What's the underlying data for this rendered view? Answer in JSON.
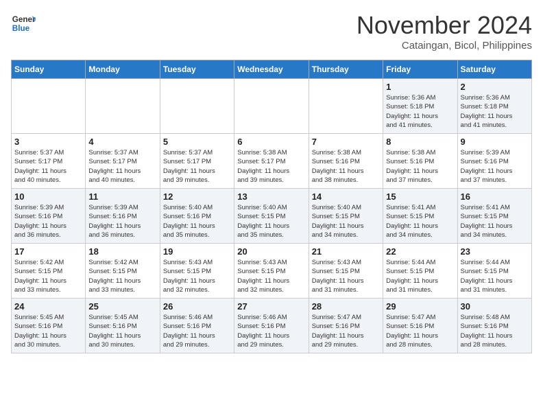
{
  "header": {
    "logo_line1": "General",
    "logo_line2": "Blue",
    "month": "November 2024",
    "location": "Cataingan, Bicol, Philippines"
  },
  "weekdays": [
    "Sunday",
    "Monday",
    "Tuesday",
    "Wednesday",
    "Thursday",
    "Friday",
    "Saturday"
  ],
  "weeks": [
    [
      {
        "day": "",
        "info": ""
      },
      {
        "day": "",
        "info": ""
      },
      {
        "day": "",
        "info": ""
      },
      {
        "day": "",
        "info": ""
      },
      {
        "day": "",
        "info": ""
      },
      {
        "day": "1",
        "info": "Sunrise: 5:36 AM\nSunset: 5:18 PM\nDaylight: 11 hours\nand 41 minutes."
      },
      {
        "day": "2",
        "info": "Sunrise: 5:36 AM\nSunset: 5:18 PM\nDaylight: 11 hours\nand 41 minutes."
      }
    ],
    [
      {
        "day": "3",
        "info": "Sunrise: 5:37 AM\nSunset: 5:17 PM\nDaylight: 11 hours\nand 40 minutes."
      },
      {
        "day": "4",
        "info": "Sunrise: 5:37 AM\nSunset: 5:17 PM\nDaylight: 11 hours\nand 40 minutes."
      },
      {
        "day": "5",
        "info": "Sunrise: 5:37 AM\nSunset: 5:17 PM\nDaylight: 11 hours\nand 39 minutes."
      },
      {
        "day": "6",
        "info": "Sunrise: 5:38 AM\nSunset: 5:17 PM\nDaylight: 11 hours\nand 39 minutes."
      },
      {
        "day": "7",
        "info": "Sunrise: 5:38 AM\nSunset: 5:16 PM\nDaylight: 11 hours\nand 38 minutes."
      },
      {
        "day": "8",
        "info": "Sunrise: 5:38 AM\nSunset: 5:16 PM\nDaylight: 11 hours\nand 37 minutes."
      },
      {
        "day": "9",
        "info": "Sunrise: 5:39 AM\nSunset: 5:16 PM\nDaylight: 11 hours\nand 37 minutes."
      }
    ],
    [
      {
        "day": "10",
        "info": "Sunrise: 5:39 AM\nSunset: 5:16 PM\nDaylight: 11 hours\nand 36 minutes."
      },
      {
        "day": "11",
        "info": "Sunrise: 5:39 AM\nSunset: 5:16 PM\nDaylight: 11 hours\nand 36 minutes."
      },
      {
        "day": "12",
        "info": "Sunrise: 5:40 AM\nSunset: 5:16 PM\nDaylight: 11 hours\nand 35 minutes."
      },
      {
        "day": "13",
        "info": "Sunrise: 5:40 AM\nSunset: 5:15 PM\nDaylight: 11 hours\nand 35 minutes."
      },
      {
        "day": "14",
        "info": "Sunrise: 5:40 AM\nSunset: 5:15 PM\nDaylight: 11 hours\nand 34 minutes."
      },
      {
        "day": "15",
        "info": "Sunrise: 5:41 AM\nSunset: 5:15 PM\nDaylight: 11 hours\nand 34 minutes."
      },
      {
        "day": "16",
        "info": "Sunrise: 5:41 AM\nSunset: 5:15 PM\nDaylight: 11 hours\nand 34 minutes."
      }
    ],
    [
      {
        "day": "17",
        "info": "Sunrise: 5:42 AM\nSunset: 5:15 PM\nDaylight: 11 hours\nand 33 minutes."
      },
      {
        "day": "18",
        "info": "Sunrise: 5:42 AM\nSunset: 5:15 PM\nDaylight: 11 hours\nand 33 minutes."
      },
      {
        "day": "19",
        "info": "Sunrise: 5:43 AM\nSunset: 5:15 PM\nDaylight: 11 hours\nand 32 minutes."
      },
      {
        "day": "20",
        "info": "Sunrise: 5:43 AM\nSunset: 5:15 PM\nDaylight: 11 hours\nand 32 minutes."
      },
      {
        "day": "21",
        "info": "Sunrise: 5:43 AM\nSunset: 5:15 PM\nDaylight: 11 hours\nand 31 minutes."
      },
      {
        "day": "22",
        "info": "Sunrise: 5:44 AM\nSunset: 5:15 PM\nDaylight: 11 hours\nand 31 minutes."
      },
      {
        "day": "23",
        "info": "Sunrise: 5:44 AM\nSunset: 5:15 PM\nDaylight: 11 hours\nand 31 minutes."
      }
    ],
    [
      {
        "day": "24",
        "info": "Sunrise: 5:45 AM\nSunset: 5:16 PM\nDaylight: 11 hours\nand 30 minutes."
      },
      {
        "day": "25",
        "info": "Sunrise: 5:45 AM\nSunset: 5:16 PM\nDaylight: 11 hours\nand 30 minutes."
      },
      {
        "day": "26",
        "info": "Sunrise: 5:46 AM\nSunset: 5:16 PM\nDaylight: 11 hours\nand 29 minutes."
      },
      {
        "day": "27",
        "info": "Sunrise: 5:46 AM\nSunset: 5:16 PM\nDaylight: 11 hours\nand 29 minutes."
      },
      {
        "day": "28",
        "info": "Sunrise: 5:47 AM\nSunset: 5:16 PM\nDaylight: 11 hours\nand 29 minutes."
      },
      {
        "day": "29",
        "info": "Sunrise: 5:47 AM\nSunset: 5:16 PM\nDaylight: 11 hours\nand 28 minutes."
      },
      {
        "day": "30",
        "info": "Sunrise: 5:48 AM\nSunset: 5:16 PM\nDaylight: 11 hours\nand 28 minutes."
      }
    ]
  ]
}
